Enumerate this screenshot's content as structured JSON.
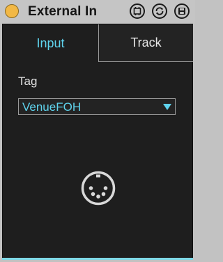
{
  "window": {
    "title": "External In",
    "fold_icon": "fold-dot-icon",
    "buttons": [
      {
        "name": "hot-swap-icon"
      },
      {
        "name": "refresh-icon"
      },
      {
        "name": "save-icon"
      }
    ]
  },
  "tabs": [
    {
      "label": "Input",
      "active": true
    },
    {
      "label": "Track",
      "active": false
    }
  ],
  "tag": {
    "label": "Tag",
    "selected": "VenueFOH",
    "arrow_icon": "dropdown-triangle-icon"
  },
  "center_icon": "midi-din-connector-icon",
  "colors": {
    "accent": "#5fd4ee",
    "panel": "#1e1e1e",
    "title_dot": "#f2b845",
    "titlebar": "#c5c5c5"
  }
}
